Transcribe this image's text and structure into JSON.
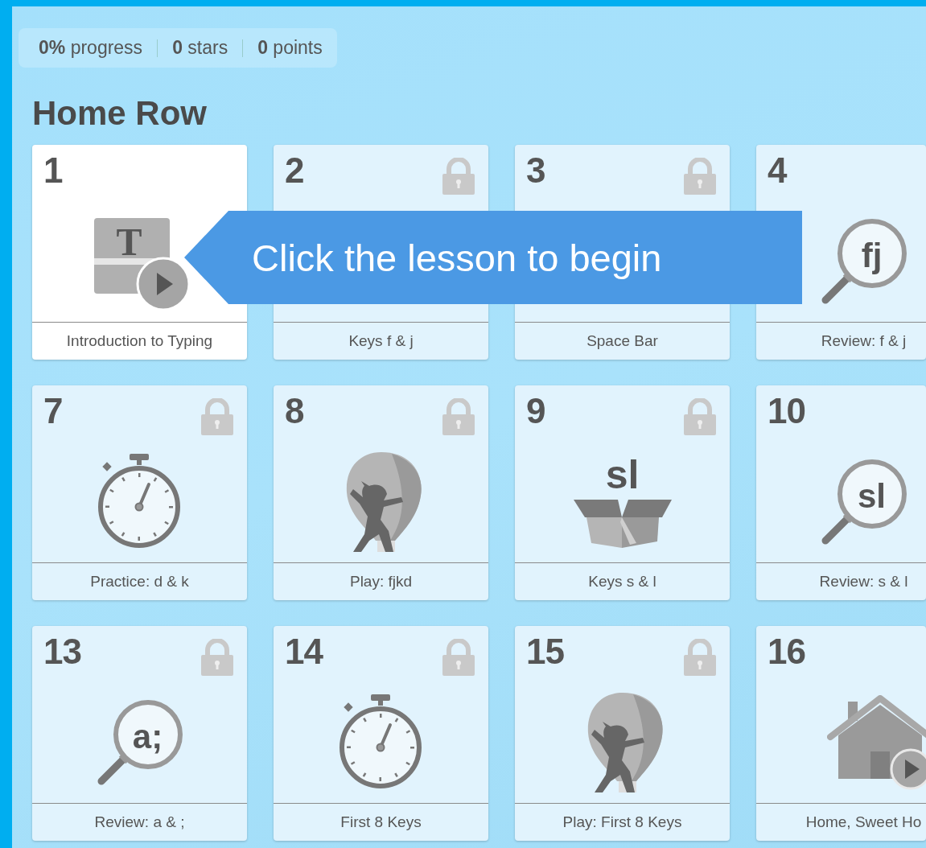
{
  "stats": [
    {
      "text": "**0%** progress"
    },
    {
      "text": "**0** stars"
    },
    {
      "text": "**0** points"
    }
  ],
  "section": {
    "title": "Home Row"
  },
  "lessons": [
    {
      "number": "1",
      "label": "Introduction to Typing",
      "selected": true,
      "locked": false,
      "kind": "gift-video",
      "icon_text": "T"
    },
    {
      "number": "2",
      "label": "Keys f & j",
      "selected": false,
      "locked": true
    },
    {
      "number": "3",
      "label": "Space Bar",
      "selected": false,
      "locked": true
    },
    {
      "number": "4",
      "label": "Review: f & j",
      "selected": false,
      "locked": false,
      "kind": "magnifier",
      "icon_text": "fj"
    },
    {
      "number": "7",
      "label": "Practice: d & k",
      "selected": false,
      "locked": true,
      "kind": "stopwatch"
    },
    {
      "number": "8",
      "label": "Play: fjkd",
      "selected": false,
      "locked": true,
      "kind": "balloon"
    },
    {
      "number": "9",
      "label": "Keys s & l",
      "selected": false,
      "locked": true,
      "kind": "box",
      "icon_text": "sl"
    },
    {
      "number": "10",
      "label": "Review: s & l",
      "selected": false,
      "locked": false,
      "kind": "magnifier",
      "icon_text": "sl"
    },
    {
      "number": "13",
      "label": "Review: a & ;",
      "selected": false,
      "locked": true,
      "kind": "magnifier",
      "icon_text": "a;"
    },
    {
      "number": "14",
      "label": "First 8 Keys",
      "selected": false,
      "locked": true,
      "kind": "stopwatch"
    },
    {
      "number": "15",
      "label": "Play: First 8 Keys",
      "selected": false,
      "locked": true,
      "kind": "balloon"
    },
    {
      "number": "16",
      "label": "Home, Sweet Ho",
      "selected": false,
      "locked": false,
      "kind": "house-video"
    }
  ],
  "tooltip": {
    "text": "Click the lesson to begin"
  }
}
